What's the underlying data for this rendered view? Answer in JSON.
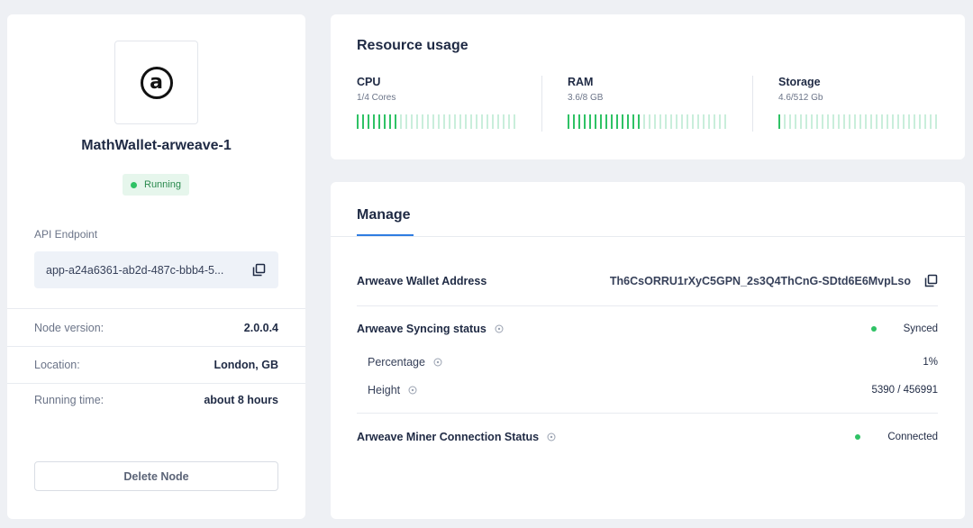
{
  "node": {
    "name": "MathWallet-arweave-1",
    "status": "Running",
    "logo_icon": "arweave-logo-icon",
    "api_label": "API Endpoint",
    "api_value": "app-a24a6361-ab2d-487c-bbb4-5...",
    "info": [
      {
        "label": "Node version:",
        "value": "2.0.0.4"
      },
      {
        "label": "Location:",
        "value": "London, GB"
      },
      {
        "label": "Running time:",
        "value": "about 8 hours"
      }
    ],
    "delete_label": "Delete Node"
  },
  "resources": {
    "title": "Resource usage",
    "items": [
      {
        "name": "CPU",
        "usage": "1/4 Cores",
        "fraction": 0.25
      },
      {
        "name": "RAM",
        "usage": "3.6/8 GB",
        "fraction": 0.45
      },
      {
        "name": "Storage",
        "usage": "4.6/512 Gb",
        "fraction": 0.009
      }
    ]
  },
  "manage": {
    "tab": "Manage",
    "wallet_label": "Arweave Wallet Address",
    "wallet_value": "Th6CsORRU1rXyC5GPN_2s3Q4ThCnG-SDtd6E6MvpLso",
    "sync_label": "Arweave Syncing status",
    "sync_value": "Synced",
    "percentage_label": "Percentage",
    "percentage_value": "1%",
    "height_label": "Height",
    "height_value": "5390 / 456991",
    "miner_label": "Arweave Miner Connection Status",
    "miner_value": "Connected"
  },
  "colors": {
    "accent": "#2f7de1",
    "success": "#2fc265",
    "bar_inactive": "#c9eedb"
  }
}
